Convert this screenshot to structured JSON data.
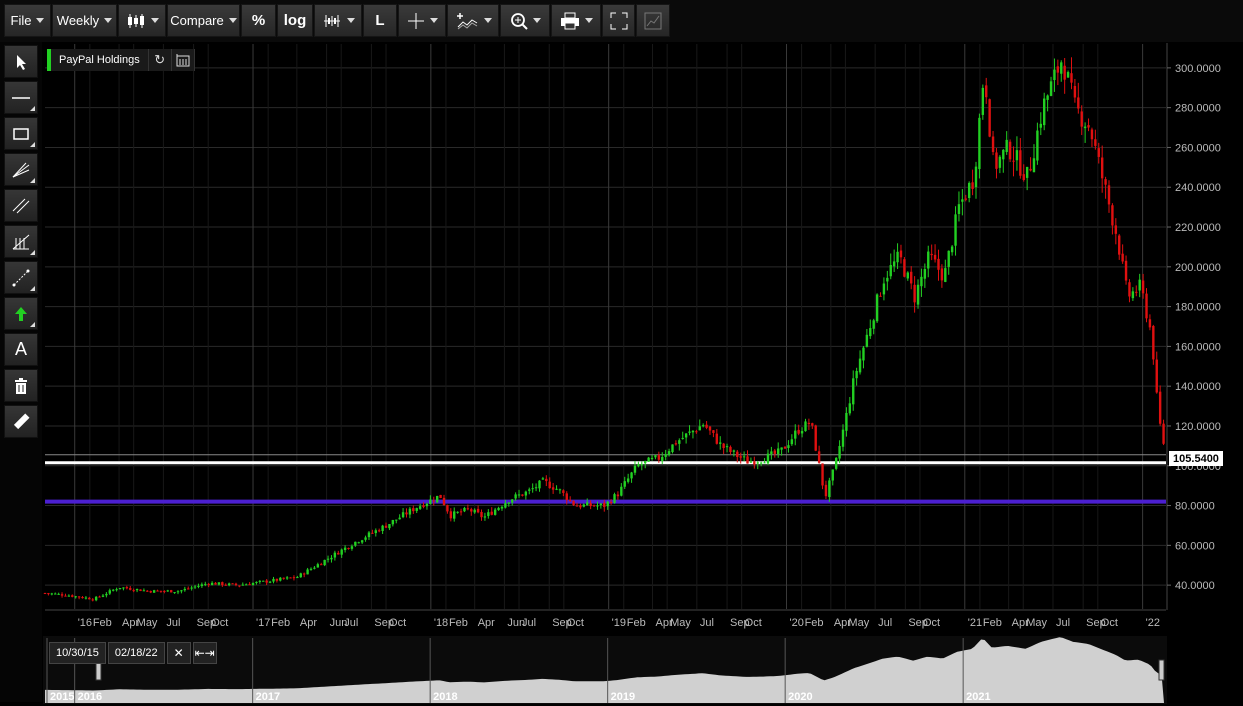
{
  "toolbar": {
    "file_label": "File",
    "interval_label": "Weekly",
    "compare_label": "Compare",
    "percent_label": "%",
    "log_label": "log",
    "line_label": "L"
  },
  "series_tag": {
    "name": "PayPal Holdings"
  },
  "last_price_label": "105.5400",
  "navigator": {
    "start_date": "10/30/15",
    "end_date": "02/18/22",
    "years": [
      "2015",
      "2016",
      "2017",
      "2018",
      "2019",
      "2020",
      "2021"
    ]
  },
  "colors": {
    "up": "#22d022",
    "down": "#e01010",
    "grid": "#2a2a2a",
    "hline_white": "#ffffff",
    "hline_purple": "#4b1fd0"
  },
  "chart_data": {
    "type": "candlestick",
    "title": "PayPal Holdings",
    "interval": "Weekly",
    "ylim": [
      28,
      312
    ],
    "yticks": [
      40,
      60,
      80,
      100,
      120,
      140,
      160,
      180,
      200,
      220,
      240,
      260,
      280,
      300
    ],
    "ytick_labels": [
      "40.0000",
      "60.0000",
      "80.0000",
      "100.0000",
      "120.0000",
      "140.0000",
      "160.0000",
      "180.0000",
      "200.0000",
      "220.0000",
      "240.0000",
      "260.0000",
      "280.0000",
      "300.0000"
    ],
    "xlim": [
      "2015-11-01",
      "2022-02-18"
    ],
    "xticks": [
      {
        "date": "2016-01-01",
        "label": "'16"
      },
      {
        "date": "2016-02-01",
        "label": "Feb"
      },
      {
        "date": "2016-04-01",
        "label": "Apr"
      },
      {
        "date": "2016-05-01",
        "label": "May"
      },
      {
        "date": "2016-07-01",
        "label": "Jul"
      },
      {
        "date": "2016-09-01",
        "label": "Sep"
      },
      {
        "date": "2016-10-01",
        "label": "Oct"
      },
      {
        "date": "2017-01-01",
        "label": "'17"
      },
      {
        "date": "2017-02-01",
        "label": "Feb"
      },
      {
        "date": "2017-04-01",
        "label": "Apr"
      },
      {
        "date": "2017-06-01",
        "label": "Jun"
      },
      {
        "date": "2017-07-01",
        "label": "Jul"
      },
      {
        "date": "2017-09-01",
        "label": "Sep"
      },
      {
        "date": "2017-10-01",
        "label": "Oct"
      },
      {
        "date": "2018-01-01",
        "label": "'18"
      },
      {
        "date": "2018-02-01",
        "label": "Feb"
      },
      {
        "date": "2018-04-01",
        "label": "Apr"
      },
      {
        "date": "2018-06-01",
        "label": "Jun"
      },
      {
        "date": "2018-07-01",
        "label": "Jul"
      },
      {
        "date": "2018-09-01",
        "label": "Sep"
      },
      {
        "date": "2018-10-01",
        "label": "Oct"
      },
      {
        "date": "2019-01-01",
        "label": "'19"
      },
      {
        "date": "2019-02-01",
        "label": "Feb"
      },
      {
        "date": "2019-04-01",
        "label": "Apr"
      },
      {
        "date": "2019-05-01",
        "label": "May"
      },
      {
        "date": "2019-07-01",
        "label": "Jul"
      },
      {
        "date": "2019-09-01",
        "label": "Sep"
      },
      {
        "date": "2019-10-01",
        "label": "Oct"
      },
      {
        "date": "2020-01-01",
        "label": "'20"
      },
      {
        "date": "2020-02-01",
        "label": "Feb"
      },
      {
        "date": "2020-04-01",
        "label": "Apr"
      },
      {
        "date": "2020-05-01",
        "label": "May"
      },
      {
        "date": "2020-07-01",
        "label": "Jul"
      },
      {
        "date": "2020-09-01",
        "label": "Sep"
      },
      {
        "date": "2020-10-01",
        "label": "Oct"
      },
      {
        "date": "2021-01-01",
        "label": "'21"
      },
      {
        "date": "2021-02-01",
        "label": "Feb"
      },
      {
        "date": "2021-04-01",
        "label": "Apr"
      },
      {
        "date": "2021-05-01",
        "label": "May"
      },
      {
        "date": "2021-07-01",
        "label": "Jul"
      },
      {
        "date": "2021-09-01",
        "label": "Sep"
      },
      {
        "date": "2021-10-01",
        "label": "Oct"
      },
      {
        "date": "2022-01-01",
        "label": "'22"
      }
    ],
    "close_path": [
      [
        "2015-11-01",
        36
      ],
      [
        "2015-12-15",
        35
      ],
      [
        "2016-02-10",
        33
      ],
      [
        "2016-04-01",
        39
      ],
      [
        "2016-06-01",
        37
      ],
      [
        "2016-08-01",
        37
      ],
      [
        "2016-10-01",
        41
      ],
      [
        "2016-12-01",
        40
      ],
      [
        "2017-02-01",
        42
      ],
      [
        "2017-04-01",
        44
      ],
      [
        "2017-06-01",
        53
      ],
      [
        "2017-08-01",
        62
      ],
      [
        "2017-10-01",
        70
      ],
      [
        "2017-12-01",
        79
      ],
      [
        "2018-01-20",
        85
      ],
      [
        "2018-02-10",
        75
      ],
      [
        "2018-03-20",
        78
      ],
      [
        "2018-04-20",
        74
      ],
      [
        "2018-06-10",
        83
      ],
      [
        "2018-07-20",
        87
      ],
      [
        "2018-08-20",
        92
      ],
      [
        "2018-09-20",
        88
      ],
      [
        "2018-10-25",
        80
      ],
      [
        "2018-12-24",
        80
      ],
      [
        "2019-01-20",
        86
      ],
      [
        "2019-03-01",
        100
      ],
      [
        "2019-04-15",
        104
      ],
      [
        "2019-05-20",
        112
      ],
      [
        "2019-07-15",
        121
      ],
      [
        "2019-08-20",
        110
      ],
      [
        "2019-09-15",
        106
      ],
      [
        "2019-10-15",
        102
      ],
      [
        "2019-11-20",
        104
      ],
      [
        "2019-12-20",
        107
      ],
      [
        "2020-01-25",
        118
      ],
      [
        "2020-02-20",
        122
      ],
      [
        "2020-03-12",
        95
      ],
      [
        "2020-03-20",
        84
      ],
      [
        "2020-04-10",
        100
      ],
      [
        "2020-05-01",
        123
      ],
      [
        "2020-05-20",
        145
      ],
      [
        "2020-06-20",
        170
      ],
      [
        "2020-07-20",
        195
      ],
      [
        "2020-08-20",
        205
      ],
      [
        "2020-09-20",
        185
      ],
      [
        "2020-10-20",
        205
      ],
      [
        "2020-11-20",
        195
      ],
      [
        "2020-12-20",
        230
      ],
      [
        "2021-01-20",
        245
      ],
      [
        "2021-02-10",
        300
      ],
      [
        "2021-03-01",
        250
      ],
      [
        "2021-04-01",
        260
      ],
      [
        "2021-05-10",
        245
      ],
      [
        "2021-06-10",
        280
      ],
      [
        "2021-07-20",
        305
      ],
      [
        "2021-08-15",
        280
      ],
      [
        "2021-09-15",
        270
      ],
      [
        "2021-10-10",
        245
      ],
      [
        "2021-11-10",
        215
      ],
      [
        "2021-12-01",
        185
      ],
      [
        "2021-12-28",
        190
      ],
      [
        "2022-01-20",
        165
      ],
      [
        "2022-02-02",
        125
      ],
      [
        "2022-02-18",
        105.54
      ]
    ],
    "horizontal_lines": [
      {
        "value": 105.54,
        "style": "thin-gray"
      },
      {
        "value": 101.5,
        "style": "white"
      },
      {
        "value": 82,
        "style": "purple"
      }
    ],
    "grid": true
  }
}
